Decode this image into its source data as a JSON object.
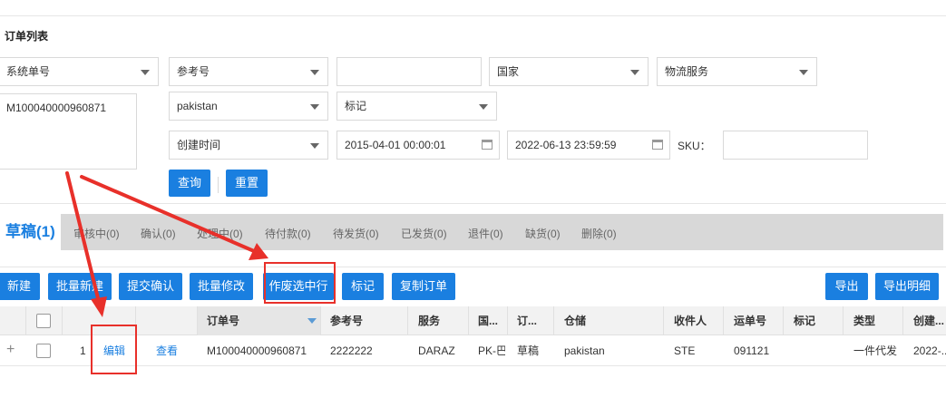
{
  "page": {
    "title": "订单列表"
  },
  "filters": {
    "order_type": "系统单号",
    "ref_type": "参考号",
    "ref_value": "",
    "country": "国家",
    "logistics": "物流服务",
    "order_numbers": "M100040000960871",
    "warehouse": "pakistan",
    "mark": "标记",
    "time_type": "创建时间",
    "start_time": "2015-04-01 00:00:01",
    "end_time": "2022-06-13 23:59:59",
    "sku_label": "SKU：",
    "sku_value": "",
    "search_label": "查询",
    "reset_label": "重置"
  },
  "tabs": {
    "active": "草稿(1)",
    "items": [
      "审核中(0)",
      "确认(0)",
      "处理中(0)",
      "待付款(0)",
      "待发货(0)",
      "已发货(0)",
      "退件(0)",
      "缺货(0)",
      "删除(0)"
    ]
  },
  "toolbar": {
    "new": "新建",
    "batch_new": "批量新建",
    "submit_confirm": "提交确认",
    "batch_edit": "批量修改",
    "void_selected": "作废选中行",
    "mark": "标记",
    "copy_order": "复制订单",
    "export": "导出",
    "export_detail": "导出明细"
  },
  "table": {
    "headers": {
      "order_no": "订单号",
      "ref_no": "参考号",
      "service": "服务",
      "country": "国...",
      "order_status": "订...",
      "warehouse": "仓储",
      "receiver": "收件人",
      "tracking_no": "运单号",
      "mark": "标记",
      "type": "类型",
      "created": "创建..."
    },
    "rows": [
      {
        "index": "1",
        "edit": "编辑",
        "view": "查看",
        "order_no": "M100040000960871",
        "ref_no": "2222222",
        "service": "DARAZ",
        "country": "PK-巴...",
        "order_status": "草稿",
        "warehouse": "pakistan",
        "receiver": "STE",
        "tracking_no": "091121",
        "mark": "",
        "type": "一件代发",
        "created": "2022-..."
      }
    ]
  },
  "colors": {
    "accent": "#1a7fe0",
    "annotation": "#e8302a",
    "tabbar": "#d8d8d8"
  }
}
